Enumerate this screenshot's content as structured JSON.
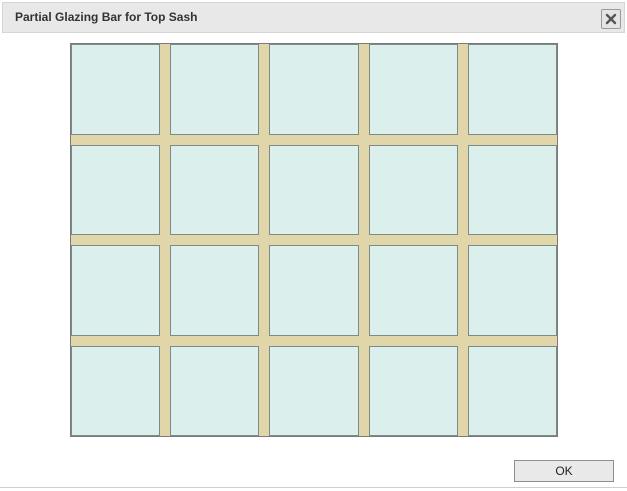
{
  "dialog": {
    "title": "Partial Glazing Bar for Top Sash",
    "close_icon": "close-icon",
    "ok_label": "OK"
  },
  "sash": {
    "columns": 5,
    "rows": 4,
    "glass_color": "#dbefec",
    "bar_color": "#e1d5aa"
  }
}
